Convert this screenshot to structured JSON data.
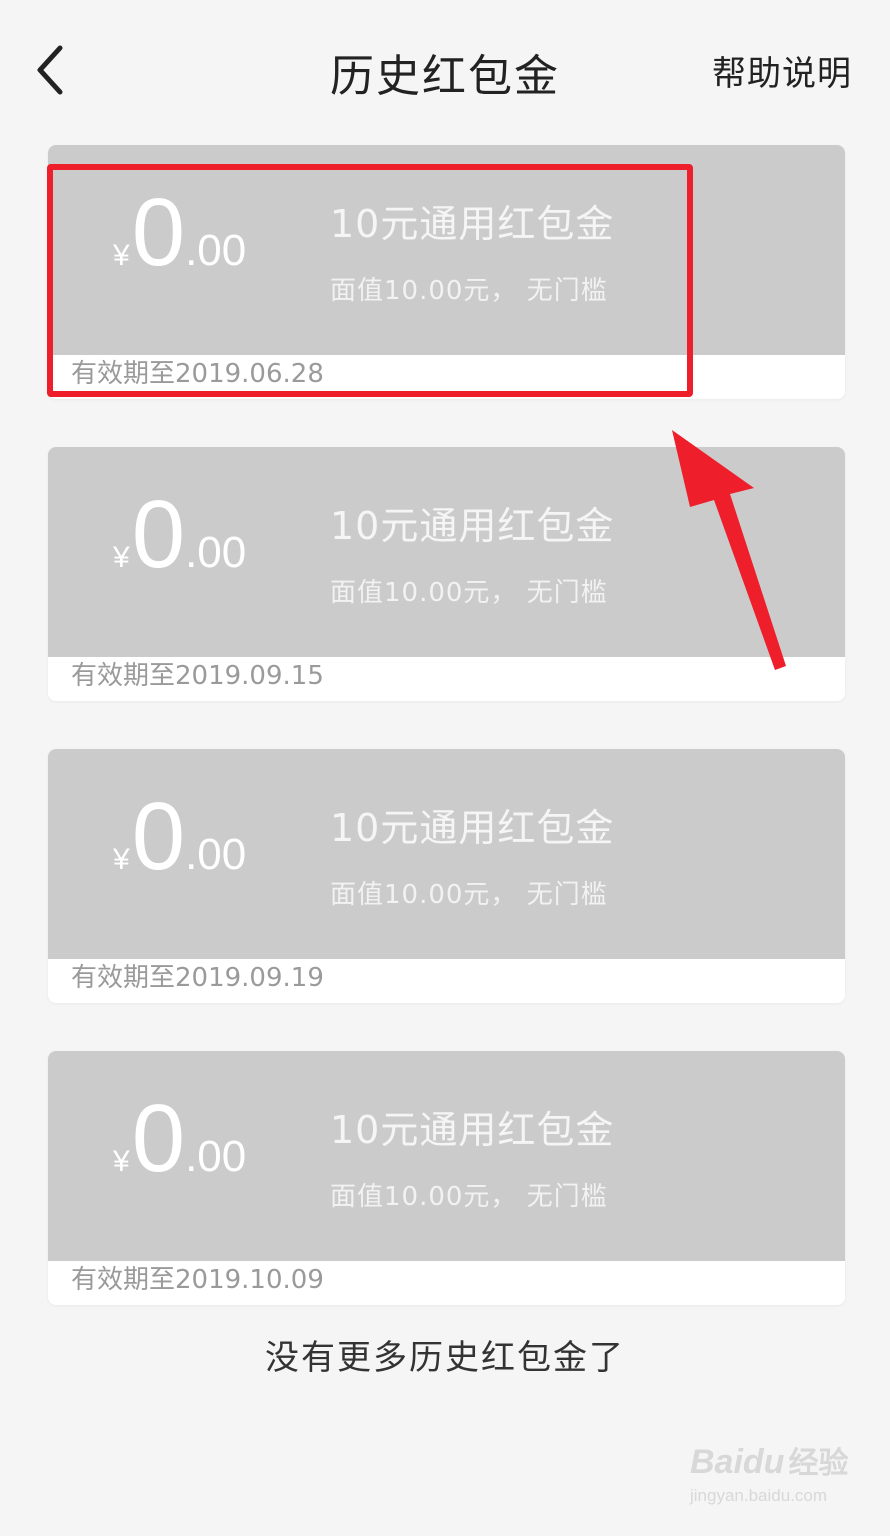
{
  "header": {
    "title": "历史红包金",
    "help_label": "帮助说明"
  },
  "coupons": [
    {
      "currency": "¥",
      "amount_int": "0",
      "amount_dec": ".00",
      "title": "10元通用红包金",
      "desc": "面值10.00元， 无门槛",
      "expiry": "有效期至2019.06.28"
    },
    {
      "currency": "¥",
      "amount_int": "0",
      "amount_dec": ".00",
      "title": "10元通用红包金",
      "desc": "面值10.00元， 无门槛",
      "expiry": "有效期至2019.09.15"
    },
    {
      "currency": "¥",
      "amount_int": "0",
      "amount_dec": ".00",
      "title": "10元通用红包金",
      "desc": "面值10.00元， 无门槛",
      "expiry": "有效期至2019.09.19"
    },
    {
      "currency": "¥",
      "amount_int": "0",
      "amount_dec": ".00",
      "title": "10元通用红包金",
      "desc": "面值10.00元， 无门槛",
      "expiry": "有效期至2019.10.09"
    }
  ],
  "footer": {
    "note": "没有更多历史红包金了"
  },
  "watermark": {
    "brand": "Baidu",
    "brand_cn": "经验",
    "url": "jingyan.baidu.com"
  },
  "colors": {
    "coupon_bg": "#cbcbcb",
    "highlight": "#ee1e2b"
  },
  "icons": {
    "back": "chevron-left-icon",
    "annotation": "red-arrow-icon"
  }
}
